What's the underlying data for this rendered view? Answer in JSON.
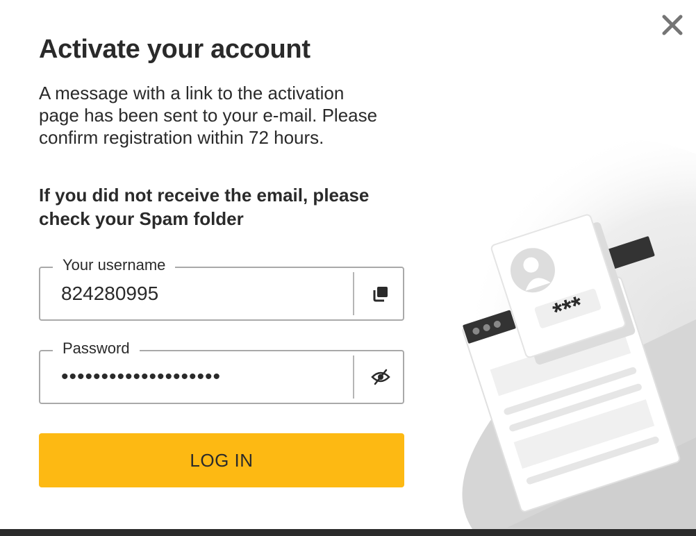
{
  "dialog": {
    "title": "Activate your account",
    "message": "A message with a link to the activation page has been sent to your e-mail. Please confirm registration within 72 hours.",
    "note": "If you did not receive the email, please check your Spam folder",
    "close_icon": "close-icon"
  },
  "username": {
    "label": "Your username",
    "value": "824280995",
    "action_icon": "copy-icon"
  },
  "password": {
    "label": "Password",
    "value": "••••••••••••••••••••",
    "action_icon": "eye-slash-icon"
  },
  "login_button": {
    "label": "LOG IN"
  },
  "illustration": {
    "asterisks": "***"
  },
  "colors": {
    "accent": "#fdb913",
    "text": "#2a2a2a",
    "border": "#a9a9a9",
    "footer": "#2b2b2b"
  }
}
